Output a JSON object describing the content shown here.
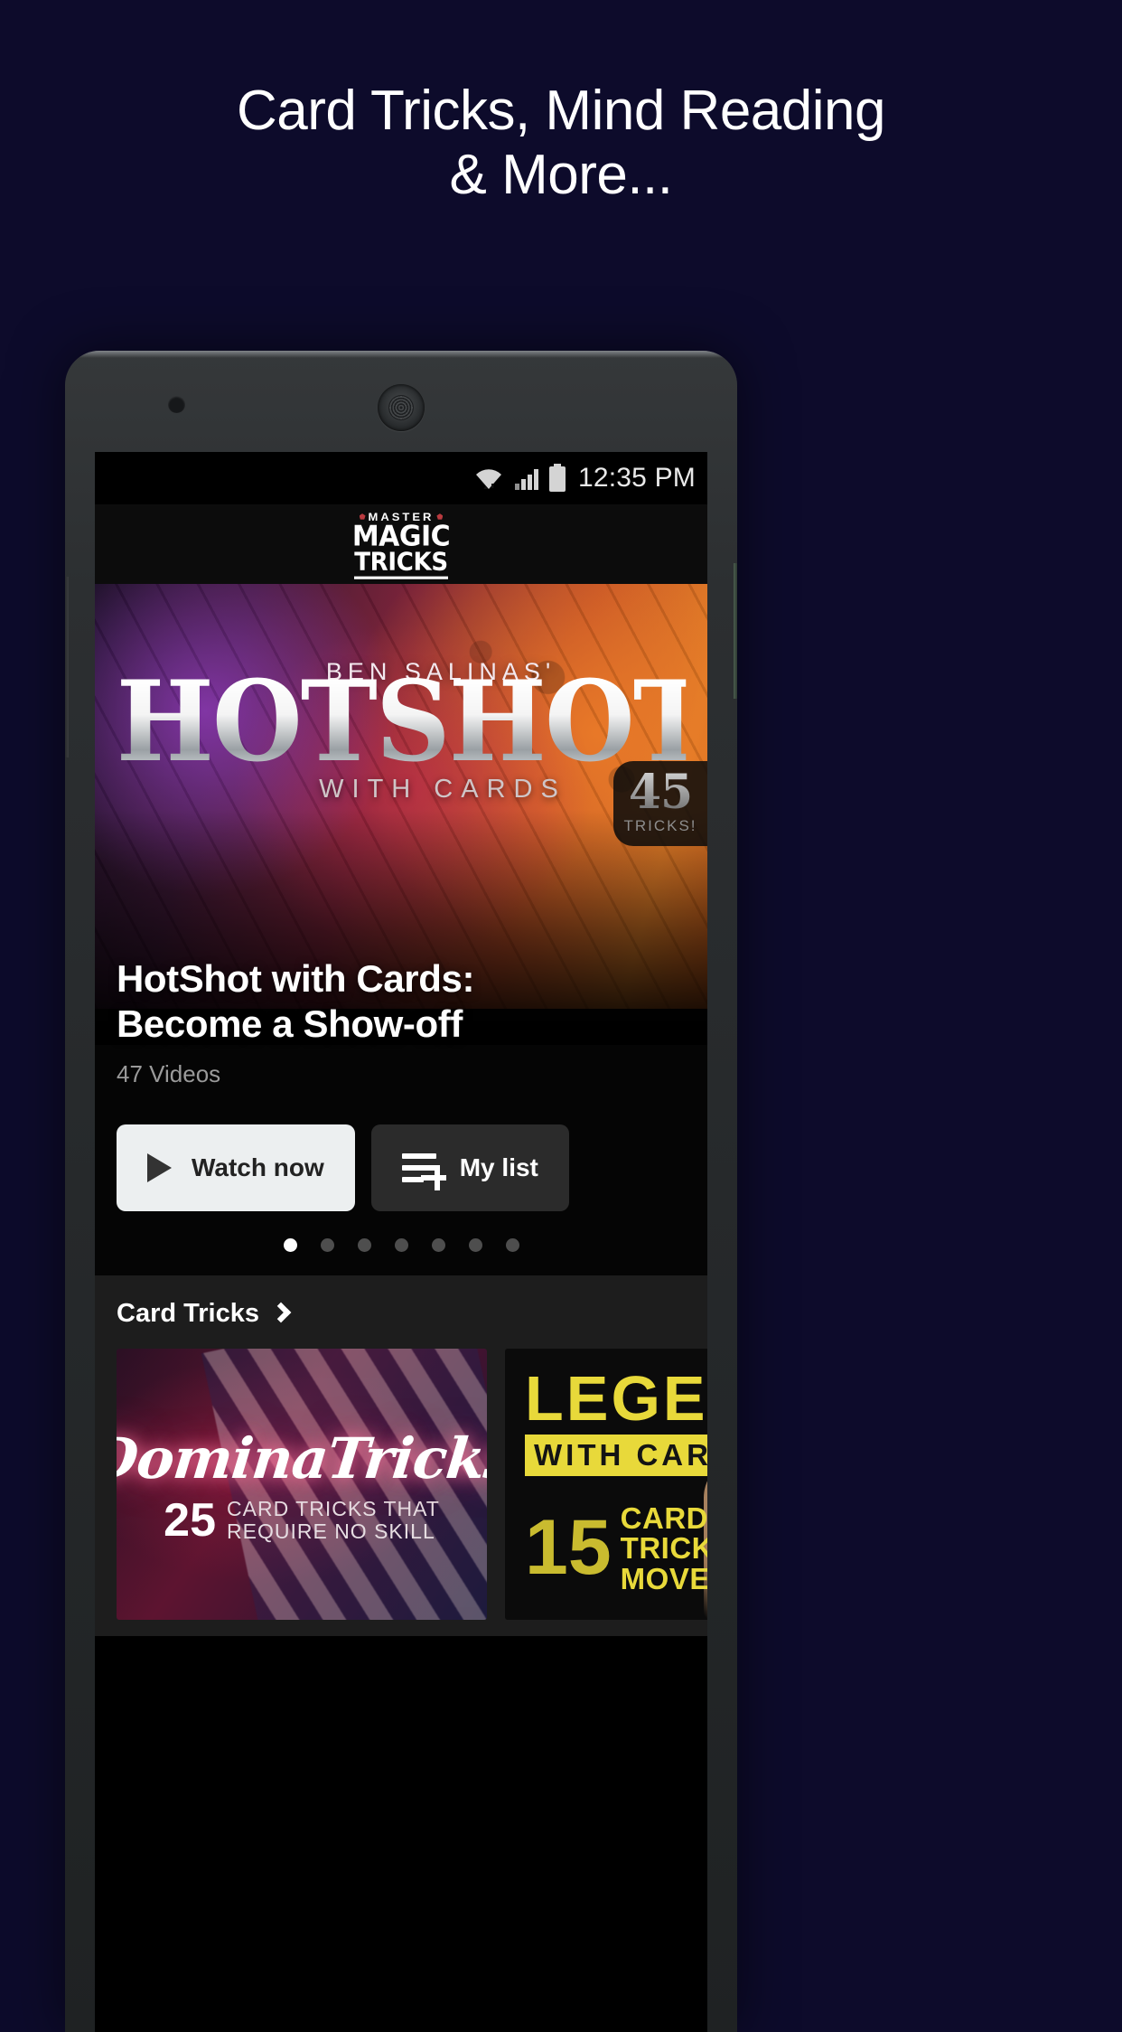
{
  "promo": {
    "headline_line1": "Card Tricks, Mind Reading",
    "headline_line2": "& More...",
    "background_color": "#0d0b2b"
  },
  "status_bar": {
    "time": "12:35 PM",
    "icons": [
      "wifi-icon",
      "cellular-signal-icon",
      "battery-icon"
    ]
  },
  "app_bar": {
    "logo_top": "MASTER",
    "logo_mid": "MAGIC",
    "logo_bottom": "TRICKS"
  },
  "hero": {
    "artwork": {
      "presenter": "BEN SALINAS'",
      "title": "HOTSHOT",
      "subtitle": "WITH CARDS"
    },
    "badge": {
      "count": "45",
      "label": "TRICKS!"
    },
    "title": "HotShot with Cards: Become a Show-off",
    "meta": "47 Videos",
    "buttons": {
      "watch_label": "Watch now",
      "mylist_label": "My list"
    },
    "carousel": {
      "total_dots": 7,
      "active_index": 0
    }
  },
  "section": {
    "title": "Card Tricks",
    "cards": [
      {
        "script_title": "DominaTricks",
        "number": "25",
        "line1": "CARD TRICKS THAT",
        "line2": "REQUIRE NO SKILL"
      },
      {
        "word": "LEGE",
        "band": "WITH CARDS",
        "number": "15",
        "line1": "CARD",
        "line2": "TRICK",
        "line3": "MOVES",
        "accent_color": "#e8d93a"
      }
    ]
  }
}
